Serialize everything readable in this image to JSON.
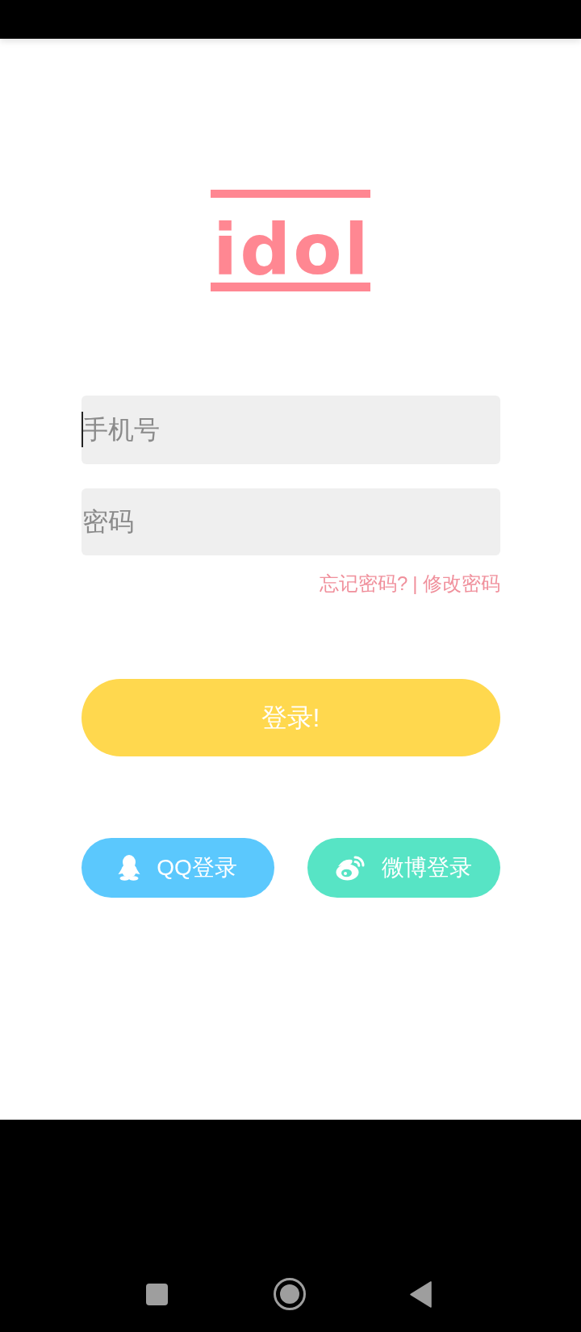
{
  "logo": {
    "text": "idol"
  },
  "form": {
    "fields": [
      {
        "placeholder": "手机号",
        "focused": true
      },
      {
        "placeholder": "密码",
        "focused": false
      }
    ],
    "links": {
      "forgot": "忘记密码?",
      "separator": "|",
      "change": "修改密码"
    },
    "login_button": {
      "label": "登录!"
    }
  },
  "social_logins": [
    {
      "kind": "qq",
      "label": "QQ登录"
    },
    {
      "kind": "weibo",
      "label": "微博登录"
    }
  ]
}
